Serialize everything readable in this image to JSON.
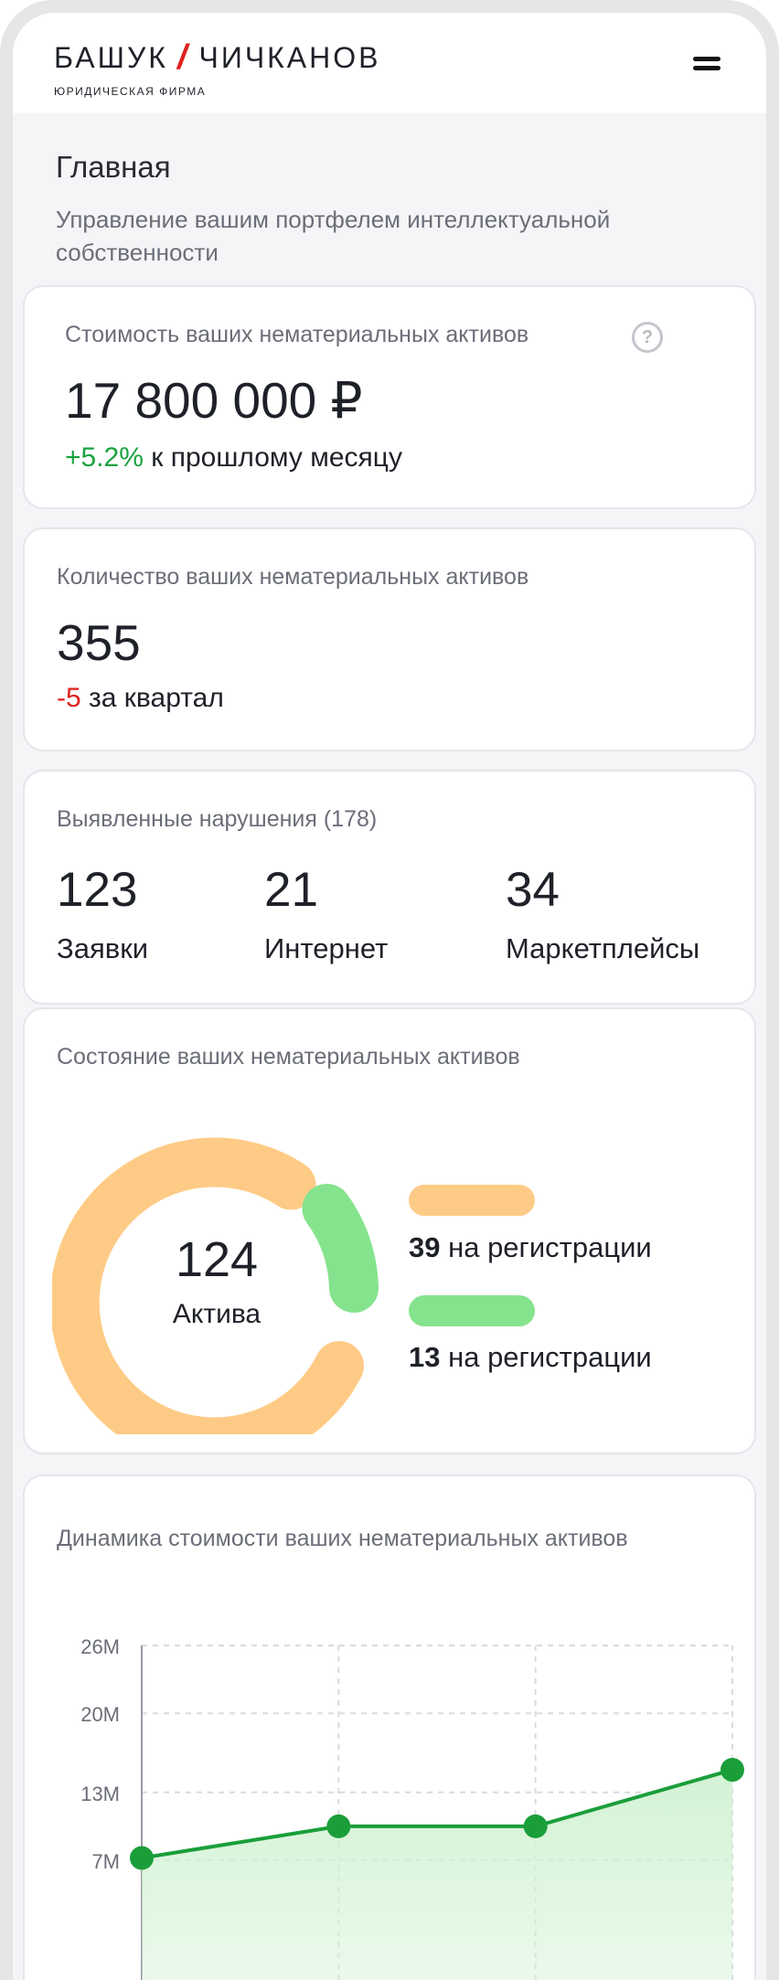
{
  "header": {
    "logo_left": "БАШУК",
    "logo_slash": "/",
    "logo_right": "ЧИЧКАНОВ",
    "logo_subtitle": "ЮРИДИЧЕСКАЯ ФИРМА",
    "menu_icon": "hamburger-menu-icon"
  },
  "page": {
    "title": "Главная",
    "subtitle": "Управление вашим портфелем интеллектуальной собственности"
  },
  "value_card": {
    "label": "Стоимость ваших нематериальных активов",
    "help_icon": "question-circle-icon",
    "help_glyph": "?",
    "amount": "17 800 000 ₽",
    "delta": "+5.2%",
    "delta_suffix": " к прошлому месяцу"
  },
  "count_card": {
    "label": "Количество ваших нематериальных активов",
    "count": "355",
    "delta": "-5",
    "delta_suffix": " за квартал"
  },
  "violations_card": {
    "label": "Выявленные нарушения (178)",
    "stats": [
      {
        "value": "123",
        "label": "Заявки"
      },
      {
        "value": "21",
        "label": "Интернет"
      },
      {
        "value": "34",
        "label": "Маркетплейсы"
      }
    ]
  },
  "status_card": {
    "label": "Состояние ваших нематериальных активов",
    "total": "124",
    "total_label": "Актива",
    "colors": {
      "orange": "#fecb86",
      "green": "#85e38d"
    },
    "legend": [
      {
        "count": "39",
        "text": " на регистрации"
      },
      {
        "count": "13",
        "text": " на регистрации"
      }
    ]
  },
  "dynamics_card": {
    "title": "Динамика стоимости ваших нематериальных активов"
  },
  "chart_data": {
    "type": "area",
    "title": "Динамика стоимости ваших нематериальных активов",
    "xlabel": "",
    "ylabel": "",
    "y_ticks": [
      "26M",
      "20M",
      "13M",
      "7M"
    ],
    "y_tick_values": [
      26,
      20,
      13,
      7
    ],
    "ylim": [
      7,
      26
    ],
    "x": [
      1,
      2,
      3,
      4
    ],
    "values": [
      7.2,
      10,
      10,
      15
    ],
    "grid": true,
    "color": "#1a9e3a",
    "fill_color": "#d3f2d4"
  }
}
